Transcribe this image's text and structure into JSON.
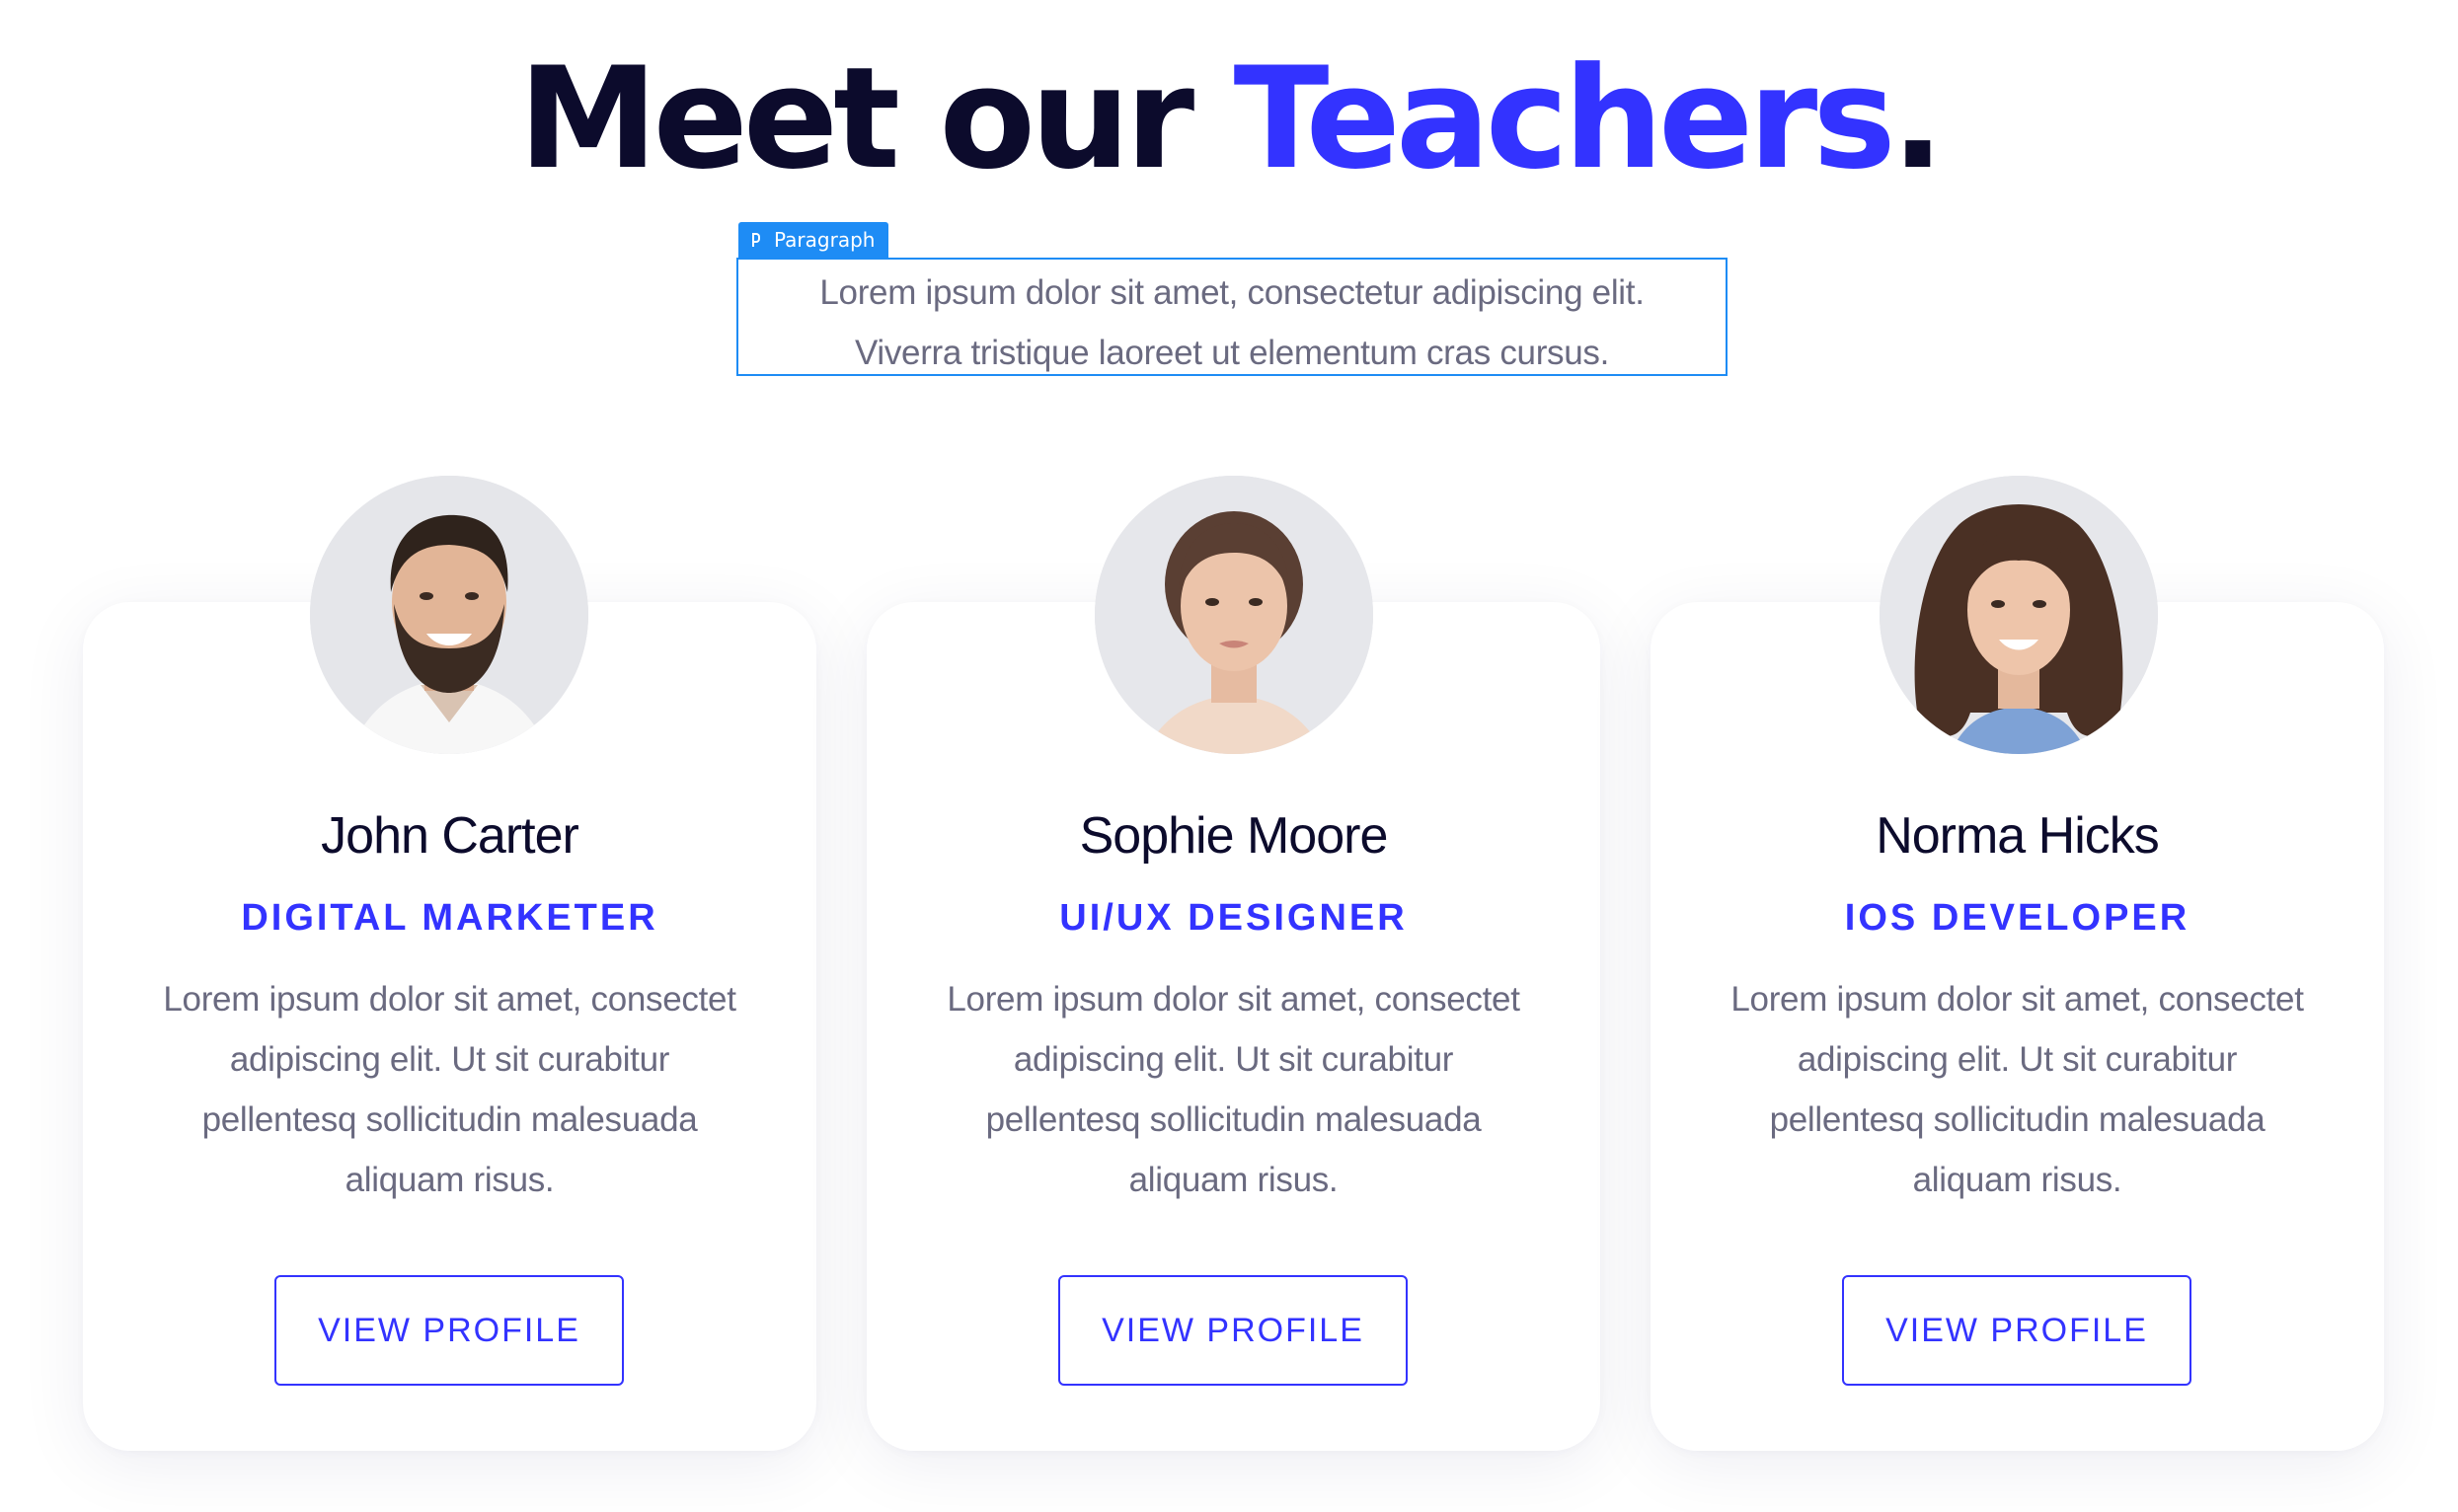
{
  "heading": {
    "main": "Meet our ",
    "accent": "Teachers",
    "end": "."
  },
  "editor_tag": {
    "icon": "paragraph-icon",
    "label": "Paragraph"
  },
  "intro": {
    "line1": "Lorem ipsum dolor sit amet, consectetur adipiscing elit.",
    "line2": "Viverra tristique laoreet ut elementum cras cursus."
  },
  "colors": {
    "heading": "#0c0b2c",
    "accent": "#3333ff",
    "body_text": "#6a6a80",
    "selection": "#1e8cf5"
  },
  "teachers": [
    {
      "name": "John Carter",
      "role": "DIGITAL MARKETER",
      "bio_lines": [
        "Lorem ipsum dolor sit amet, consectet",
        "adipiscing elit. Ut sit curabitur",
        "pellentesq sollicitudin malesuada",
        "aliquam risus."
      ],
      "button": "VIEW PROFILE",
      "photo": "man-portrait"
    },
    {
      "name": "Sophie Moore",
      "role": "UI/UX DESIGNER",
      "bio_lines": [
        "Lorem ipsum dolor sit amet, consectet",
        "adipiscing elit. Ut sit curabitur",
        "pellentesq sollicitudin malesuada",
        "aliquam risus."
      ],
      "button": "VIEW PROFILE",
      "photo": "woman-portrait"
    },
    {
      "name": "Norma Hicks",
      "role": "IOS DEVELOPER",
      "bio_lines": [
        "Lorem ipsum dolor sit amet, consectet",
        "adipiscing elit. Ut sit curabitur",
        "pellentesq sollicitudin malesuada",
        "aliquam risus."
      ],
      "button": "VIEW PROFILE",
      "photo": "woman-portrait"
    }
  ]
}
